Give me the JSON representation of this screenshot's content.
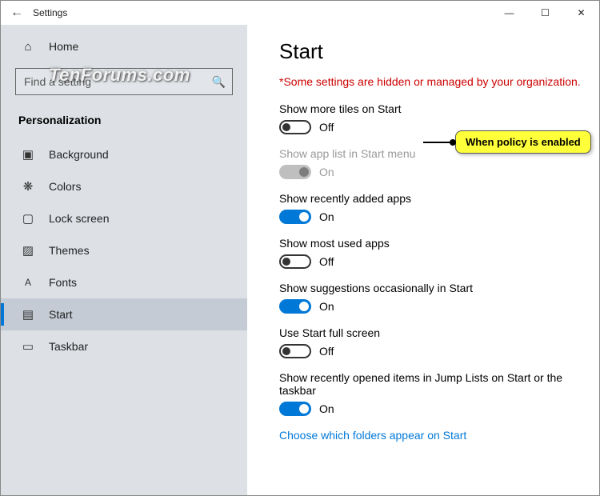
{
  "window": {
    "title": "Settings",
    "search_placeholder": "Find a setting"
  },
  "watermark": "TenForums.com",
  "nav": {
    "home": "Home",
    "category": "Personalization",
    "items": [
      {
        "label": "Background",
        "icon": "▣"
      },
      {
        "label": "Colors",
        "icon": "❋"
      },
      {
        "label": "Lock screen",
        "icon": "▢"
      },
      {
        "label": "Themes",
        "icon": "▨"
      },
      {
        "label": "Fonts",
        "icon": "A"
      },
      {
        "label": "Start",
        "icon": "▤",
        "selected": true
      },
      {
        "label": "Taskbar",
        "icon": "▭"
      }
    ]
  },
  "main": {
    "heading": "Start",
    "policy_note": "*Some settings are hidden or managed by your organization.",
    "settings": [
      {
        "label": "Show more tiles on Start",
        "state": "Off",
        "on": false,
        "disabled": false
      },
      {
        "label": "Show app list in Start menu",
        "state": "On",
        "on": true,
        "disabled": true
      },
      {
        "label": "Show recently added apps",
        "state": "On",
        "on": true,
        "disabled": false
      },
      {
        "label": "Show most used apps",
        "state": "Off",
        "on": false,
        "disabled": false
      },
      {
        "label": "Show suggestions occasionally in Start",
        "state": "On",
        "on": true,
        "disabled": false
      },
      {
        "label": "Use Start full screen",
        "state": "Off",
        "on": false,
        "disabled": false
      },
      {
        "label": "Show recently opened items in Jump Lists on Start or the taskbar",
        "state": "On",
        "on": true,
        "disabled": false
      }
    ],
    "link": "Choose which folders appear on Start"
  },
  "callout": "When policy is enabled"
}
